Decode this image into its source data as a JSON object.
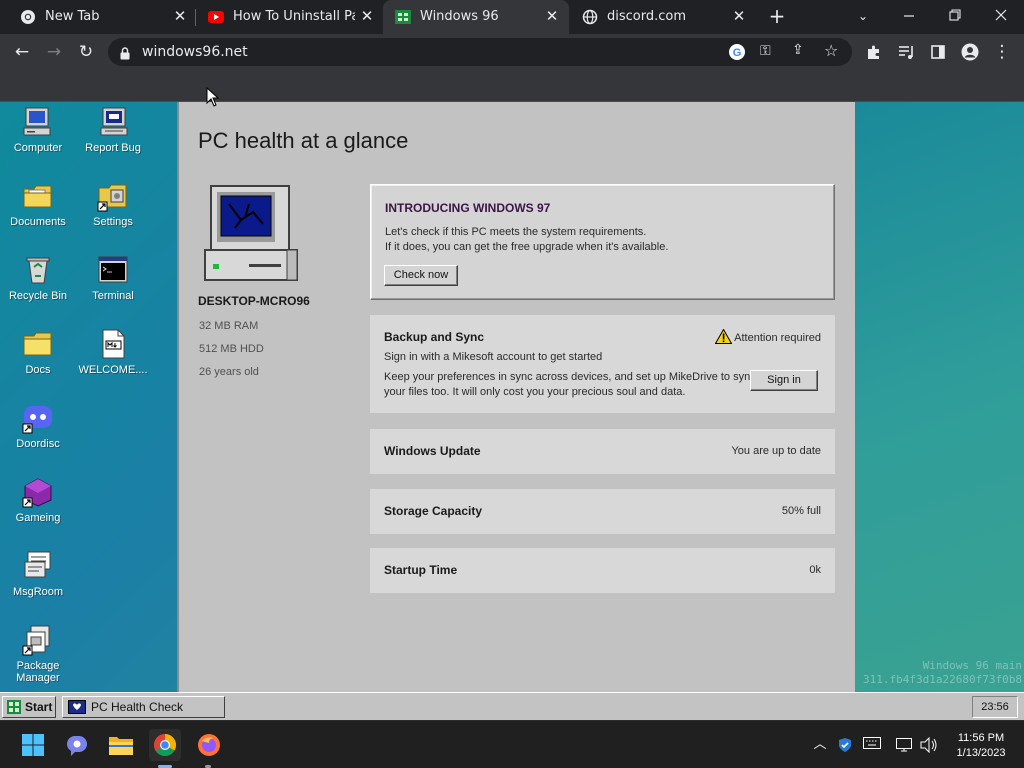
{
  "browser": {
    "tabs": [
      {
        "title": "New Tab",
        "icon": "chrome-icon"
      },
      {
        "title": "How To Uninstall Panda",
        "icon": "youtube-icon"
      },
      {
        "title": "Windows 96",
        "icon": "windows96-icon"
      },
      {
        "title": "discord.com",
        "icon": "globe-icon"
      }
    ],
    "active_tab": 2,
    "new_tab_symbol": "+",
    "url": "windows96.net"
  },
  "desktop": {
    "icons": [
      {
        "label": "Computer",
        "icon": "computer-icon"
      },
      {
        "label": "Report Bug",
        "icon": "report-bug-icon"
      },
      {
        "label": "Documents",
        "icon": "documents-folder-icon"
      },
      {
        "label": "Settings",
        "icon": "settings-icon"
      },
      {
        "label": "Recycle Bin",
        "icon": "recycle-bin-icon"
      },
      {
        "label": "Terminal",
        "icon": "terminal-icon"
      },
      {
        "label": "Docs",
        "icon": "docs-folder-icon"
      },
      {
        "label": "WELCOME....",
        "icon": "markdown-file-icon"
      },
      {
        "label": "Doordisc",
        "icon": "doordisc-icon"
      },
      {
        "label": "Gameing",
        "icon": "gameing-icon"
      },
      {
        "label": "MsgRoom",
        "icon": "msgroom-icon"
      },
      {
        "label": "Package Manager",
        "icon": "package-manager-icon"
      }
    ],
    "watermark_lines": [
      "Windows 96 main",
      "311.fb4f3d1a22680f73f0b8"
    ]
  },
  "health": {
    "title": "PC health at a glance",
    "pc_name": "DESKTOP-MCRO96",
    "specs": [
      "32 MB RAM",
      "512 MB HDD",
      "26 years old"
    ],
    "intro": {
      "title": "INTRODUCING WINDOWS 97",
      "line1": "Let's check if this PC meets the system requirements.",
      "line2": "If it does, you can get the free upgrade when it's available.",
      "button": "Check now"
    },
    "backup": {
      "title": "Backup and Sync",
      "status": "Attention required",
      "subtitle": "Sign in with a Mikesoft account to get started",
      "line1": "Keep your preferences in sync across devices, and set up MikeDrive to sync",
      "line2": "your files too. It will only cost you your precious soul and data.",
      "button": "Sign in"
    },
    "rows": [
      {
        "title": "Windows Update",
        "value": "You are up to date"
      },
      {
        "title": "Storage Capacity",
        "value": "50% full"
      },
      {
        "title": "Startup Time",
        "value": "0k"
      }
    ]
  },
  "w96_taskbar": {
    "start_label": "Start",
    "window_label": "PC Health Check",
    "clock": "23:56"
  },
  "system": {
    "time": "11:56 PM",
    "date": "1/13/2023"
  }
}
